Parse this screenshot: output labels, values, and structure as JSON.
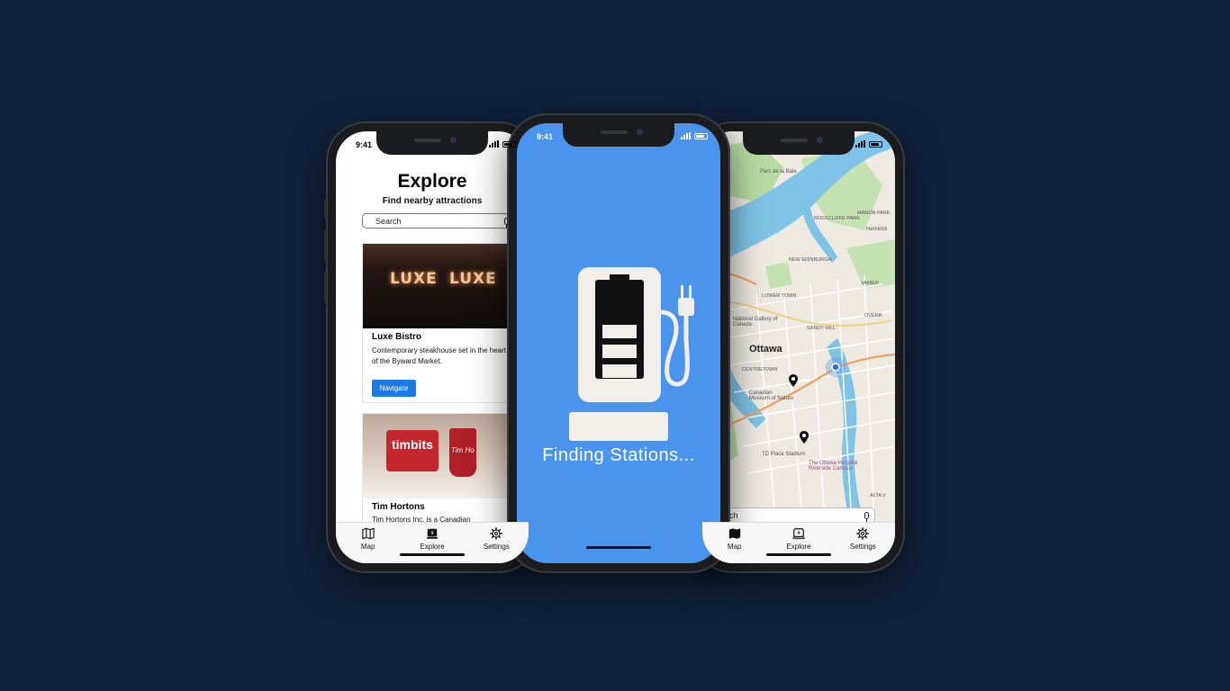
{
  "status": {
    "time": "9:41"
  },
  "explore": {
    "title": "Explore",
    "subtitle": "Find nearby attractions",
    "search_placeholder": "Search",
    "cards": [
      {
        "name": "Luxe Bistro",
        "description": "Contemporary steakhouse set in the heart of the Byward Market.",
        "button": "Navigate",
        "image_sign": "LUXE"
      },
      {
        "name": "Tim Hortons",
        "description": "Tim Hortons Inc. is a Canadian",
        "image_box_text": "timbits",
        "image_cup_text": "Tim Ho"
      }
    ],
    "tabs": [
      {
        "label": "Map",
        "icon": "map-icon"
      },
      {
        "label": "Explore",
        "icon": "charging-station-icon"
      },
      {
        "label": "Settings",
        "icon": "gear-icon"
      }
    ]
  },
  "loading": {
    "text": "Finding Stations...",
    "icon": "ev-charger-icon",
    "background": "#4a94ee"
  },
  "map": {
    "search_text": "rch",
    "labels": {
      "parc": "Parc de la Baie",
      "rockcliffe": "ROCKCLIFFE PARK",
      "manor": "MANOR PARK",
      "hemlock": "Hemlock",
      "new_edinburgh": "NEW EDINBURGH",
      "lower_town": "LOWER TOWN",
      "vanier": "VANIER",
      "national_gallery": "National Gallery of Canada",
      "sandy_hill": "SANDY HILL",
      "overbrook": "OVERB",
      "city": "Ottawa",
      "centretown": "CENTRETOWN",
      "museum": "Canadian Museum of Nature",
      "td_place": "TD Place Stadium",
      "hospital": "The Ottawa Hospital Riverside Campus",
      "alta_vista": "ALTA V"
    },
    "tabs": [
      {
        "label": "Map",
        "icon": "map-icon"
      },
      {
        "label": "Explore",
        "icon": "charging-station-icon"
      },
      {
        "label": "Settings",
        "icon": "gear-icon"
      }
    ]
  },
  "colors": {
    "background": "#10233d",
    "accent_button": "#1b7ae6",
    "map_water": "#7fc4e6",
    "map_park": "#b9dca6"
  }
}
